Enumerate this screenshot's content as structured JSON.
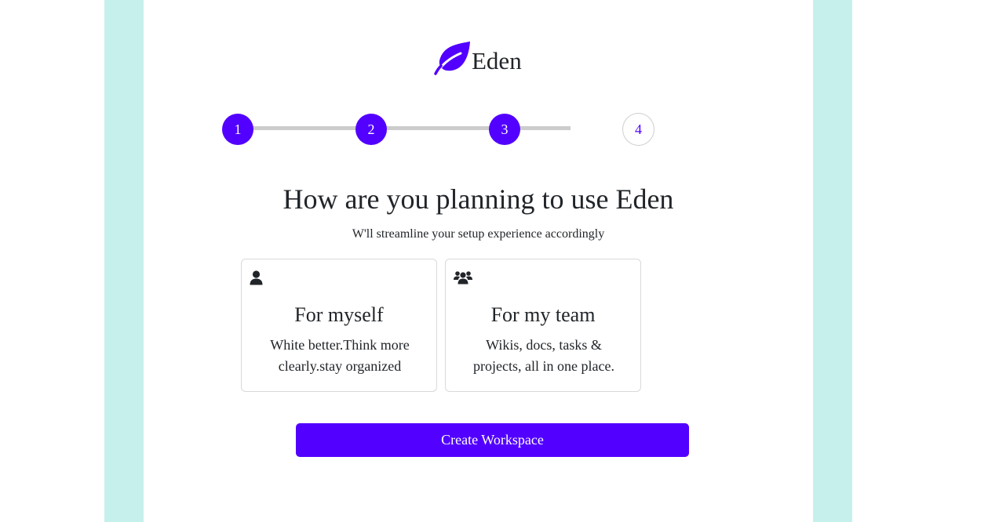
{
  "brand": {
    "name": "Eden",
    "color": "#5200ff"
  },
  "stepper": {
    "steps": [
      {
        "label": "1",
        "state": "done"
      },
      {
        "label": "2",
        "state": "done"
      },
      {
        "label": "3",
        "state": "done"
      },
      {
        "label": "4",
        "state": "pending"
      }
    ],
    "active_color": "#5200ff",
    "line_color": "#cccccc"
  },
  "main": {
    "title": "How are you planning to use Eden",
    "subtitle": "W'll streamline your setup experience accordingly"
  },
  "options": [
    {
      "icon": "user-icon",
      "title": "For myself",
      "description": "White better.Think more clearly.stay organized"
    },
    {
      "icon": "users-icon",
      "title": "For my team",
      "description": "Wikis, docs, tasks & projects, all in one place."
    }
  ],
  "actions": {
    "create_label": "Create Workspace"
  },
  "theme": {
    "side_band_color": "#c6f0ec",
    "accent": "#5200ff"
  }
}
